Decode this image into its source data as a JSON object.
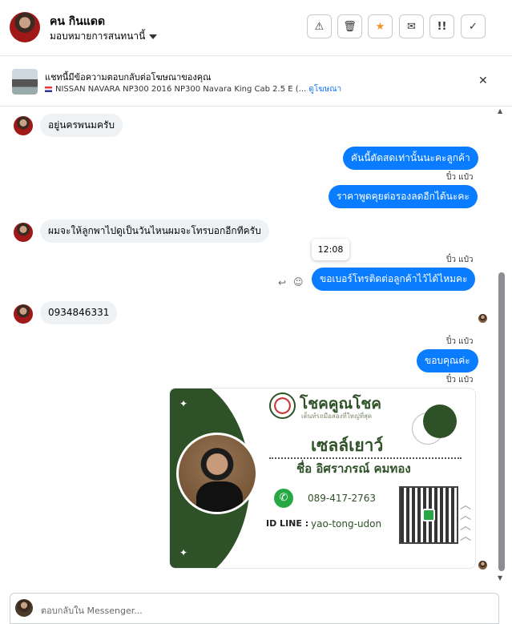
{
  "header": {
    "contact_name": "คน กินแดด",
    "assign_label": "มอบหมายการสนทนานี้",
    "actions": [
      {
        "name": "report-button",
        "glyph": "⚠"
      },
      {
        "name": "delete-button",
        "glyph": "🗑"
      },
      {
        "name": "star-button",
        "glyph": "★",
        "color": "#f0932b"
      },
      {
        "name": "mark-unread-button",
        "glyph": "✉"
      },
      {
        "name": "follow-up-button",
        "glyph": "!!"
      },
      {
        "name": "mark-done-button",
        "glyph": "✓"
      }
    ]
  },
  "ad": {
    "title": "แชทนี้มีข้อความตอบกลับต่อโฆษณาของคุณ",
    "listing": "NISSAN NAVARA NP300 2016 NP300 Navara King Cab 2.5 E (...",
    "link": "ดูโฆษณา"
  },
  "messages": {
    "in1": "อยู่นครพนมครับ",
    "out1": "คันนี้ตัดสดเท่านั้นนะคะลูกค้า",
    "out2": "ราคาพูดคุยต่อรองลดอีกได้นะคะ",
    "in2": "ผมจะให้ลูกพาไปดูเป็นวันไหนผมจะโทรบอกอีกทีครับ",
    "out3": "ขอเบอร์โทรติดต่อลูกค้าไว้ได้ไหมคะ",
    "in3": "0934846331",
    "out4": "ขอบคุณค่ะ",
    "sender_label": "ปิ๋ว แป๋ว",
    "tooltip_time": "12:08"
  },
  "card": {
    "brand": "โชคคูณโชค",
    "tagline": "เต็นท์รถมือสองที่ใหญ่ที่สุด",
    "nickname": "เซลล์เยาว์",
    "fullname": "ชื่อ อิศราภรณ์  คมทอง",
    "phone": "089-417-2763",
    "id_label": "ID LINE :",
    "id_value": "yao-tong-udon"
  },
  "composer": {
    "placeholder": "ตอบกลับใน Messenger..."
  },
  "colors": {
    "accent": "#0a7cff",
    "card_green": "#2f5128",
    "star": "#f0932b"
  }
}
